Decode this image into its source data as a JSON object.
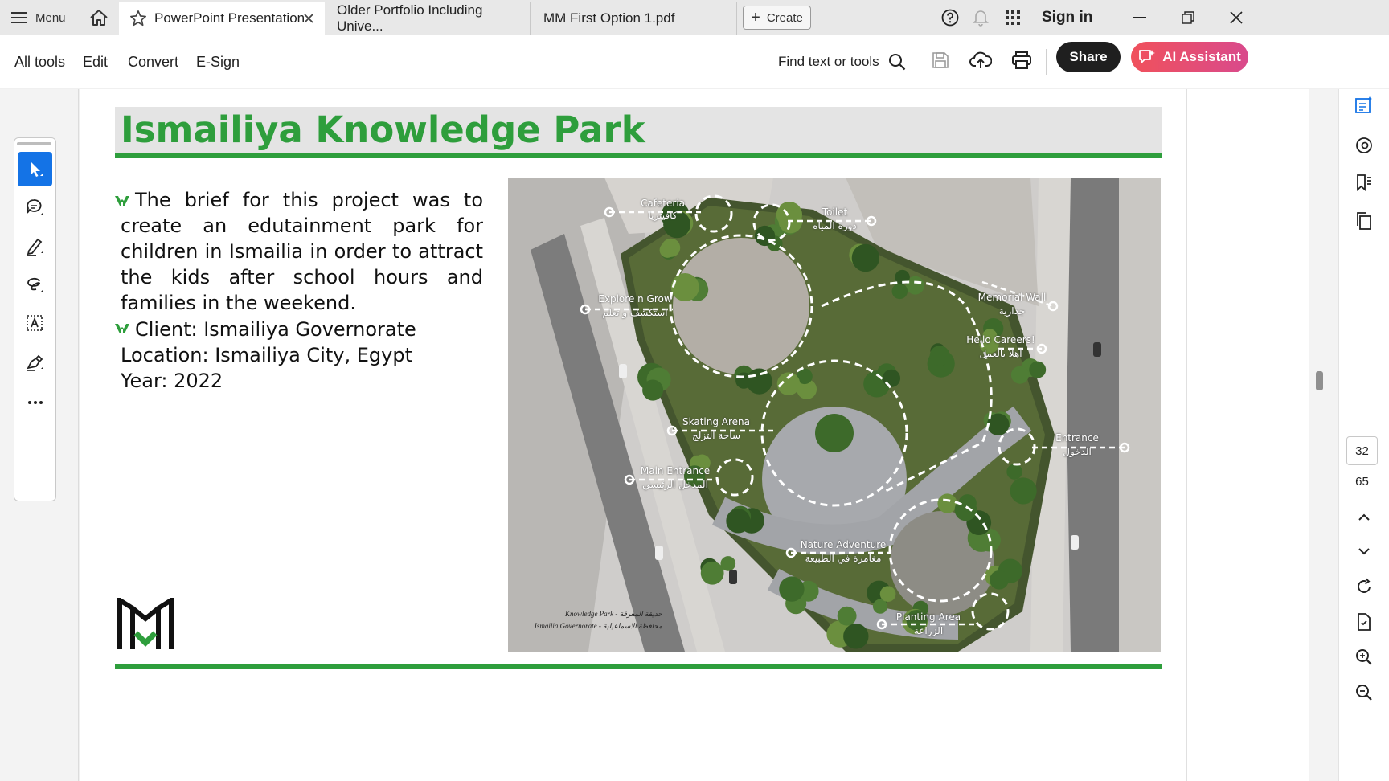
{
  "tabs": {
    "menu_label": "Menu",
    "items": [
      {
        "label": "PowerPoint Presentation"
      },
      {
        "label": "Older Portfolio Including Unive..."
      },
      {
        "label": "MM  First Option 1.pdf"
      }
    ],
    "create_label": "Create",
    "sign_in_label": "Sign in"
  },
  "toolbar": {
    "menu": [
      "All tools",
      "Edit",
      "Convert",
      "E-Sign"
    ],
    "find_label": "Find text or tools",
    "share_label": "Share",
    "ai_label": "AI Assistant"
  },
  "slide": {
    "title": "Ismailiya Knowledge Park",
    "brief": "The brief for this project was to create an edutainment park for children in Ismailia in order to attract the kids after school hours and families in the weekend.",
    "client": "Client: Ismailiya Governorate",
    "location": "Location: Ismailiya City, Egypt",
    "year": "Year: 2022",
    "map_labels": [
      {
        "en": "Cafeteria",
        "ar": "كافيتريا"
      },
      {
        "en": "Toilet",
        "ar": "دورة المياه"
      },
      {
        "en": "Explore n Grow",
        "ar": "استكشف و تعلم"
      },
      {
        "en": "Memorial Wall",
        "ar": "جدارية"
      },
      {
        "en": "Hello Careers!",
        "ar": "اهلا بالعمل"
      },
      {
        "en": "Skating Arena",
        "ar": "ساحة التزلج"
      },
      {
        "en": "Entrance",
        "ar": "الدخول"
      },
      {
        "en": "Main Entrance",
        "ar": "المدخل الرئيسي"
      },
      {
        "en": "Nature Adventure",
        "ar": "مغامرة في الطبيعة"
      },
      {
        "en": "Planting Area",
        "ar": "الزراعة"
      }
    ],
    "caption_line1": "Knowledge Park - حديقة المعرفة",
    "caption_line2": "Ismailia Governorate - محافظة الاسماعيلية"
  },
  "page_nav": {
    "current_page": "32",
    "total_pages": "65"
  },
  "colors": {
    "accent_green": "#2e9e3c",
    "share_bg": "#1f1f1f",
    "ai_bg": "#ea4f62",
    "select_blue": "#1473e6"
  }
}
